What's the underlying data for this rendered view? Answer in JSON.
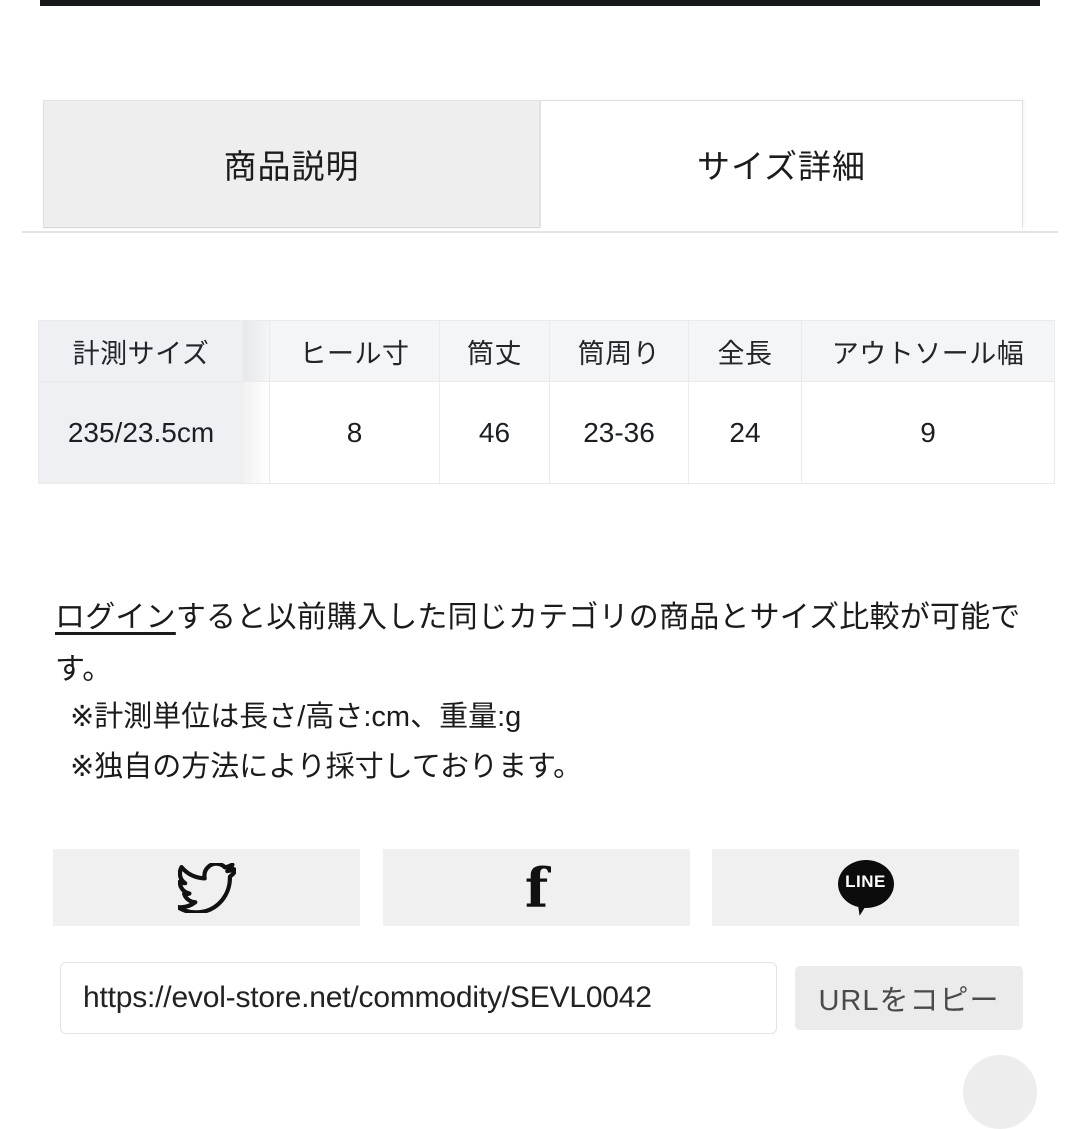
{
  "top_bar": {
    "present": true,
    "color": "#17181a"
  },
  "tabs": [
    {
      "label": "商品説明",
      "active": false
    },
    {
      "label": "サイズ詳細",
      "active": true
    }
  ],
  "size_table": {
    "headers": [
      "計測サイズ",
      "",
      "ヒール寸",
      "筒丈",
      "筒周り",
      "全長",
      "アウトソール幅"
    ],
    "rows": [
      [
        "235/23.5cm",
        "",
        "8",
        "46",
        "23-36",
        "24",
        "9"
      ]
    ]
  },
  "login_note": {
    "link_text": "ログイン",
    "rest_text": "すると以前購入した同じカテゴリの商品とサイズ比較が可能です。"
  },
  "measure_notes": [
    "※計測単位は長さ/高さ:cm、重量:g",
    "※独自の方法により採寸しております。"
  ],
  "share": {
    "twitter_icon": "twitter-bird-icon",
    "facebook_icon": "facebook-f-icon",
    "facebook_glyph": "f",
    "line_icon": "line-bubble-icon",
    "line_label": "LINE"
  },
  "url_bar": {
    "value": "https://evol-store.net/commodity/SEVL0042",
    "placeholder": "https://evol-store.net/commodity/SEVL0042",
    "copy_label": "URLをコピー"
  },
  "colors": {
    "tab_inactive_bg": "#eeeeee",
    "tab_active_bg": "#ffffff",
    "table_header_bg": "#f4f5f7",
    "sticky_col_bg": "#eff0f3",
    "share_btn_bg": "#f0f0f0",
    "copy_btn_bg": "#ebebeb",
    "text": "#1b1b1b"
  }
}
